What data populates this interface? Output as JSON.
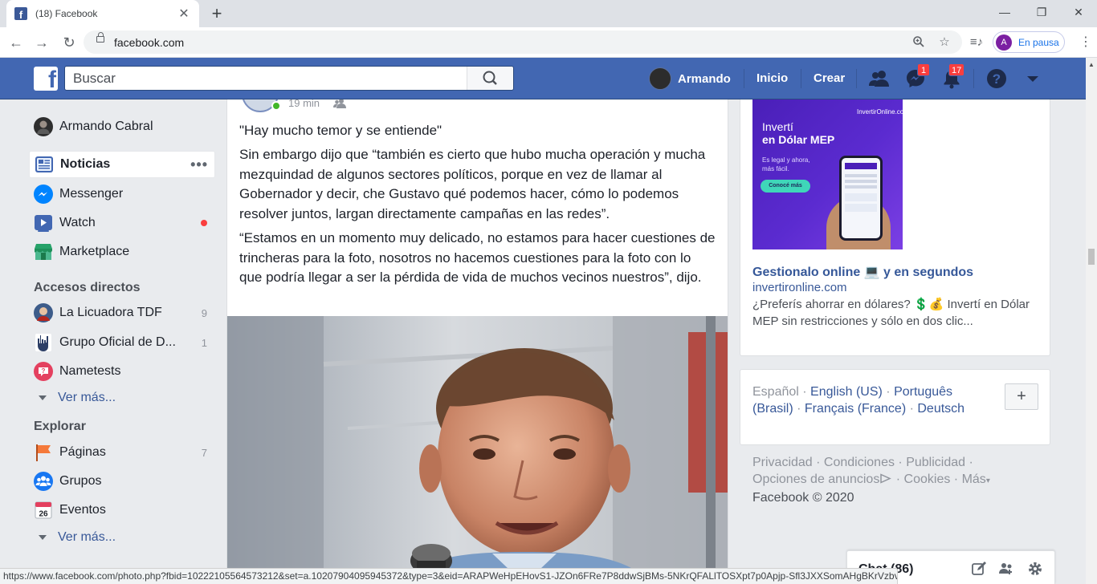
{
  "browser": {
    "tab_title": "(18) Facebook",
    "url": "facebook.com",
    "profile_label": "En pausa",
    "profile_initial": "A",
    "status_url": "https://www.facebook.com/photo.php?fbid=10222105564573212&set=a.10207904095945372&type=3&eid=ARAPWeHpEHovS1-JZOn6FRe7P8ddwSjBMs-5NKrQFALlTOSXpt7p0Apjp-Sfl3JXXSomAHgBKrVzbvH"
  },
  "fb": {
    "search_placeholder": "Buscar",
    "user_name": "Armando",
    "nav_home": "Inicio",
    "nav_create": "Crear",
    "messenger_badge": "1",
    "notifications_badge": "17",
    "brand_color": "#4267b2"
  },
  "leftnav": {
    "profile_name": "Armando Cabral",
    "main": [
      {
        "label": "Noticias",
        "icon": "news-feed-icon"
      },
      {
        "label": "Messenger",
        "icon": "messenger-icon"
      },
      {
        "label": "Watch",
        "icon": "watch-icon"
      },
      {
        "label": "Marketplace",
        "icon": "marketplace-icon"
      }
    ],
    "shortcuts_header": "Accesos directos",
    "shortcuts": [
      {
        "label": "La Licuadora TDF",
        "count": "9"
      },
      {
        "label": "Grupo Oficial de D...",
        "count": "1"
      },
      {
        "label": "Nametests",
        "count": ""
      }
    ],
    "see_more_1": "Ver más...",
    "explore_header": "Explorar",
    "explore": [
      {
        "label": "Páginas",
        "count": "7"
      },
      {
        "label": "Grupos",
        "count": ""
      },
      {
        "label": "Eventos",
        "count": "",
        "day": "26"
      }
    ],
    "see_more_2": "Ver más..."
  },
  "post": {
    "time": "19 min",
    "paragraphs": [
      "\"Hay mucho temor y se entiende\"",
      "Sin embargo dijo que “también es cierto que hubo mucha operación y mucha mezquindad de algunos sectores políticos, porque en vez de llamar al Gobernador y decir, che Gustavo qué podemos hacer, cómo lo podemos resolver juntos, largan directamente campañas en las redes”.",
      "“Estamos en un momento muy delicado, no estamos para hacer cuestiones de trincheras para la foto, nosotros no hacemos cuestiones para la foto con lo que podría llegar a ser la pérdida de vida de muchos vecinos nuestros”, dijo."
    ]
  },
  "ad": {
    "img_brand": "InvertirOnline.com",
    "img_line1": "Invertí",
    "img_line2": "en Dólar MEP",
    "img_sub": "Es legal y ahora, más fácil.",
    "img_cta": "Conocé más",
    "title": "Gestionalo online 💻 y en segundos",
    "site": "invertironline.com",
    "description": "¿Preferís ahorrar en dólares? 💲💰 Invertí en Dólar MEP sin restricciones y sólo en dos clic..."
  },
  "languages": {
    "current": "Español",
    "others": [
      "English (US)",
      "Português (Brasil)",
      "Français (France)",
      "Deutsch"
    ],
    "add_label": "+"
  },
  "footer": {
    "links": [
      "Privacidad",
      "Condiciones",
      "Publicidad",
      "Opciones de anuncios",
      "Cookies",
      "Más"
    ],
    "copyright": "Facebook © 2020"
  },
  "chat": {
    "title": "Chat (86)"
  }
}
